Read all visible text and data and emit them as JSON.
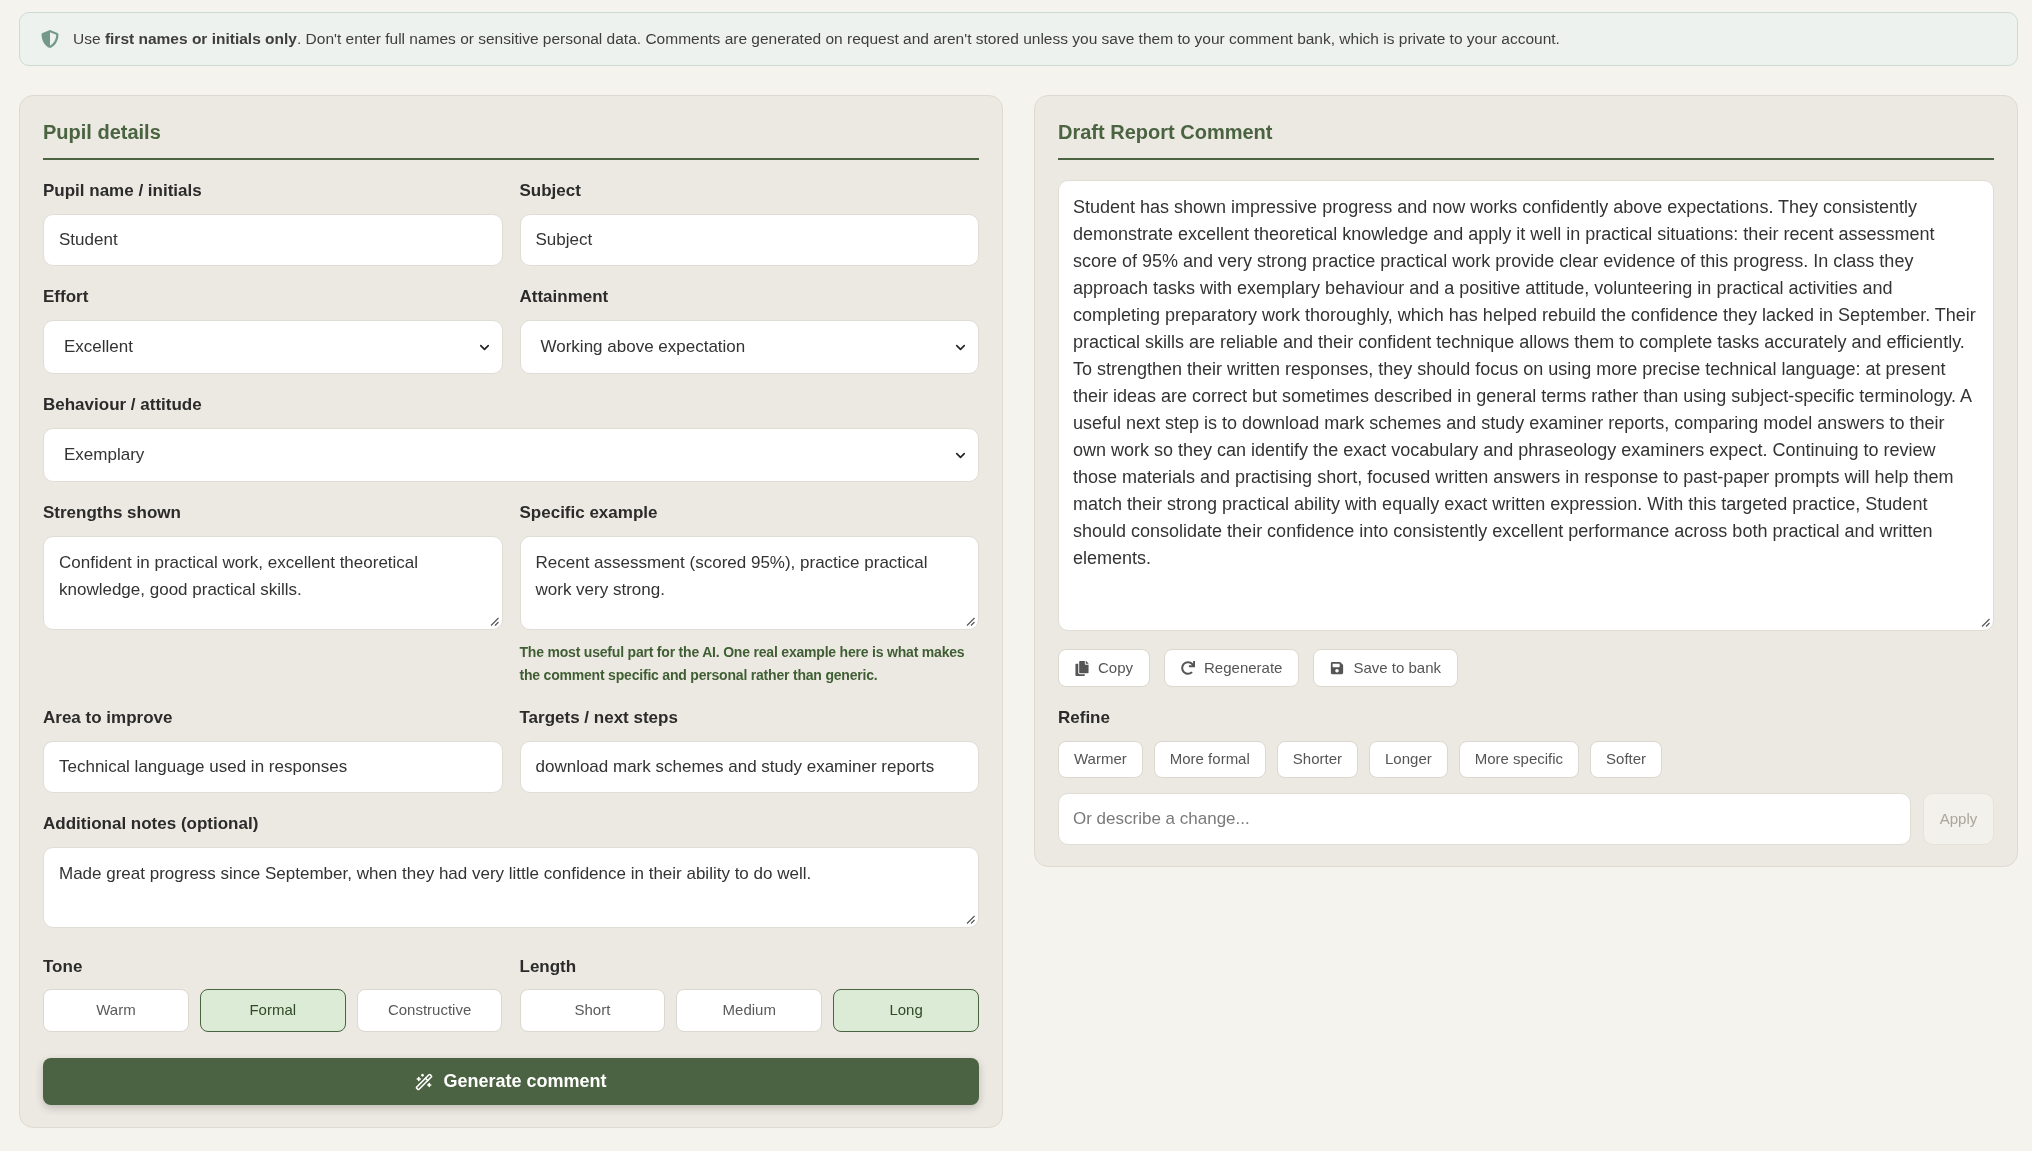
{
  "notice": {
    "text": "Use **first names or initials only**. Don't enter full names or sensitive personal data. Comments are generated on request and aren't stored unless you save them to your comment bank, which is private to your account."
  },
  "pupil_details": {
    "title": "Pupil details",
    "rows": [
      [
        {
          "kind": "text",
          "label": "Pupil name / initials",
          "value": "Student"
        },
        {
          "kind": "text",
          "label": "Subject",
          "value": "Subject"
        }
      ],
      [
        {
          "kind": "select",
          "label": "Effort",
          "value": "Excellent"
        },
        {
          "kind": "select",
          "label": "Attainment",
          "value": "Working above expectation"
        }
      ],
      [
        {
          "kind": "select",
          "label": "Behaviour / attitude",
          "value": "Exemplary"
        }
      ],
      [
        {
          "kind": "textarea",
          "label": "Strengths shown",
          "value": "Confident in practical work, excellent theoretical knowledge, good practical skills."
        },
        {
          "kind": "textarea",
          "label": "Specific example",
          "value": "Recent assessment (scored 95%), practice practical work very strong.",
          "hint": "The most useful part for the AI. One real example here is what makes the comment specific and personal rather than generic."
        }
      ],
      [
        {
          "kind": "text",
          "label": "Area to improve",
          "value": "Technical language used in responses"
        },
        {
          "kind": "text",
          "label": "Targets / next steps",
          "value": "download mark schemes and study examiner reports"
        }
      ],
      [
        {
          "kind": "textarea",
          "label": "Additional notes (optional)",
          "value": "Made great progress since September, when they had very little confidence in their ability to do well."
        }
      ]
    ],
    "choice_groups": [
      {
        "label": "Tone",
        "options": [
          {
            "label": "Warm",
            "selected": false
          },
          {
            "label": "Formal",
            "selected": true
          },
          {
            "label": "Constructive",
            "selected": false
          }
        ]
      },
      {
        "label": "Length",
        "options": [
          {
            "label": "Short",
            "selected": false
          },
          {
            "label": "Medium",
            "selected": false
          },
          {
            "label": "Long",
            "selected": true
          }
        ]
      }
    ],
    "generate_button": {
      "label": "Generate comment"
    }
  },
  "draft": {
    "title": "Draft Report Comment",
    "comment": "Student has shown impressive progress and now works confidently above expectations. They consistently demonstrate excellent theoretical knowledge and apply it well in practical situations: their recent assessment score of 95% and very strong practice practical work provide clear evidence of this progress. In class they approach tasks with exemplary behaviour and a positive attitude, volunteering in practical activities and completing preparatory work thoroughly, which has helped rebuild the confidence they lacked in September. Their practical skills are reliable and their confident technique allows them to complete tasks accurately and efficiently. To strengthen their written responses, they should focus on using more precise technical language: at present their ideas are correct but sometimes described in general terms rather than using subject-specific terminology. A useful next step is to download mark schemes and study examiner reports, comparing model answers to their own work so they can identify the exact vocabulary and phraseology examiners expect. Continuing to review those materials and practising short, focused written answers in response to past-paper prompts will help them match their strong practical ability with equally exact written expression. With this targeted practice, Student should consolidate their confidence into consistently excellent performance across both practical and written elements.",
    "actions": [
      {
        "kind": "copy",
        "label": "Copy"
      },
      {
        "kind": "regenerate",
        "label": "Regenerate"
      },
      {
        "kind": "save",
        "label": "Save to bank"
      }
    ],
    "refine": {
      "label": "Refine",
      "chips": [
        "Warmer",
        "More formal",
        "Shorter",
        "Longer",
        "More specific",
        "Softer"
      ],
      "input": {
        "placeholder": "Or describe a change..."
      },
      "apply": {
        "label": "Apply",
        "disabled": true
      }
    }
  }
}
